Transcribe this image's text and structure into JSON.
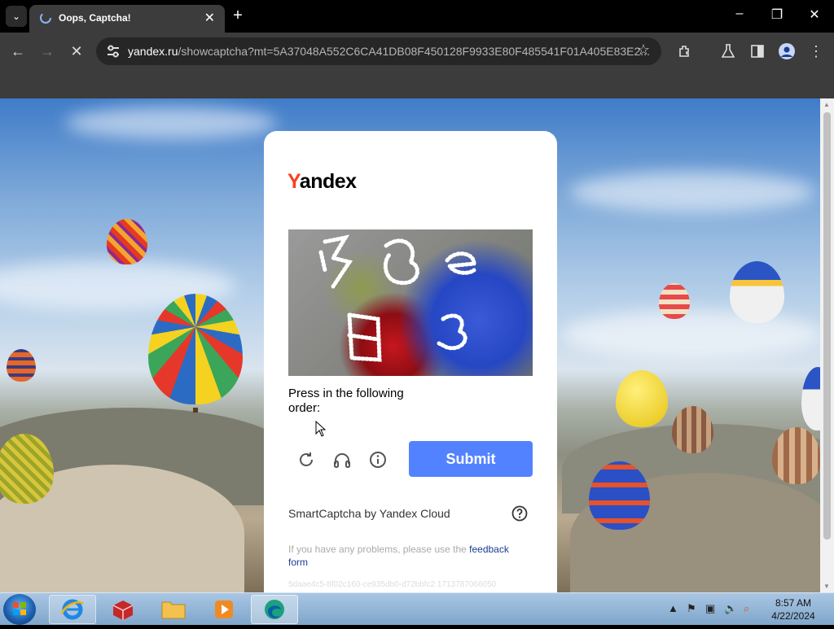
{
  "browser": {
    "tab_title": "Oops, Captcha!",
    "url_host": "yandex.ru",
    "url_path": "/showcaptcha?mt=5A37048A552C6CA41DB08F450128F9933E80F485541F01A405E83E2..."
  },
  "captcha": {
    "logo_first": "Y",
    "logo_rest": "andex",
    "prompt": "Press in the following order:",
    "submit_label": "Submit",
    "brand": "SmartCaptcha by Yandex Cloud",
    "footer_text": "If you have any problems, please use the ",
    "footer_link": "feedback form",
    "request_id": "5daae4c5-8f02c160-ce935db0-d72bbfc2 1713787066050"
  },
  "taskbar": {
    "time": "8:57 AM",
    "date": "4/22/2024"
  }
}
